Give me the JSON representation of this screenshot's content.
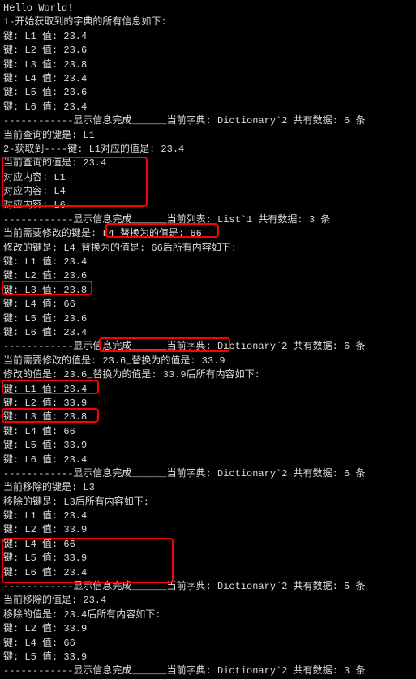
{
  "lines": {
    "l0": "Hello World!",
    "l1": "1-开始获取到的字典的所有信息如下:",
    "l2": "键: L1 值: 23.4",
    "l3": "键: L2 值: 23.6",
    "l4": "键: L3 值: 23.8",
    "l5": "键: L4 值: 23.4",
    "l6": "键: L5 值: 23.6",
    "l7": "键: L6 值: 23.4",
    "l8": "------------显示信息完成______当前字典: Dictionary`2 共有数据: 6 条",
    "l9": "",
    "l10": "当前查询的键是: L1",
    "l11": "2-获取到----键: L1对应的值是: 23.4",
    "l12": "当前查询的值是: 23.4",
    "l13": "对应内容: L1",
    "l14": "对应内容: L4",
    "l15": "对应内容: L6",
    "l16": "------------显示信息完成______当前列表: List`1 共有数据: 3 条",
    "l17": "",
    "l18": "当前需要修改的键是: L4_替换为的值是: 66",
    "l19": "修改的键是: L4_替换为的值是: 66后所有内容如下:",
    "l20": "键: L1 值: 23.4",
    "l21": "键: L2 值: 23.6",
    "l22": "键: L3 值: 23.8",
    "l23": "键: L4 值: 66",
    "l24": "键: L5 值: 23.6",
    "l25": "键: L6 值: 23.4",
    "l26": "------------显示信息完成______当前字典: Dictionary`2 共有数据: 6 条",
    "l27": "",
    "l28": "当前需要修改的值是: 23.6_替换为的值是: 33.9",
    "l29": "修改的值是: 23.6_替换为的值是: 33.9后所有内容如下:",
    "l30": "键: L1 值: 23.4",
    "l31": "键: L2 值: 33.9",
    "l32": "键: L3 值: 23.8",
    "l33": "键: L4 值: 66",
    "l34": "键: L5 值: 33.9",
    "l35": "键: L6 值: 23.4",
    "l36": "------------显示信息完成______当前字典: Dictionary`2 共有数据: 6 条",
    "l37": "",
    "l38": "当前移除的键是: L3",
    "l39": "移除的键是: L3后所有内容如下:",
    "l40": "键: L1 值: 23.4",
    "l41": "键: L2 值: 33.9",
    "l42": "键: L4 值: 66",
    "l43": "键: L5 值: 33.9",
    "l44": "键: L6 值: 23.4",
    "l45": "------------显示信息完成______当前字典: Dictionary`2 共有数据: 5 条",
    "l46": "",
    "l47": "当前移除的值是: 23.4",
    "l48": "移除的值是: 23.4后所有内容如下:",
    "l49": "键: L2 值: 33.9",
    "l50": "键: L4 值: 66",
    "l51": "键: L5 值: 33.9",
    "l52": "------------显示信息完成______当前字典: Dictionary`2 共有数据: 3 条"
  }
}
